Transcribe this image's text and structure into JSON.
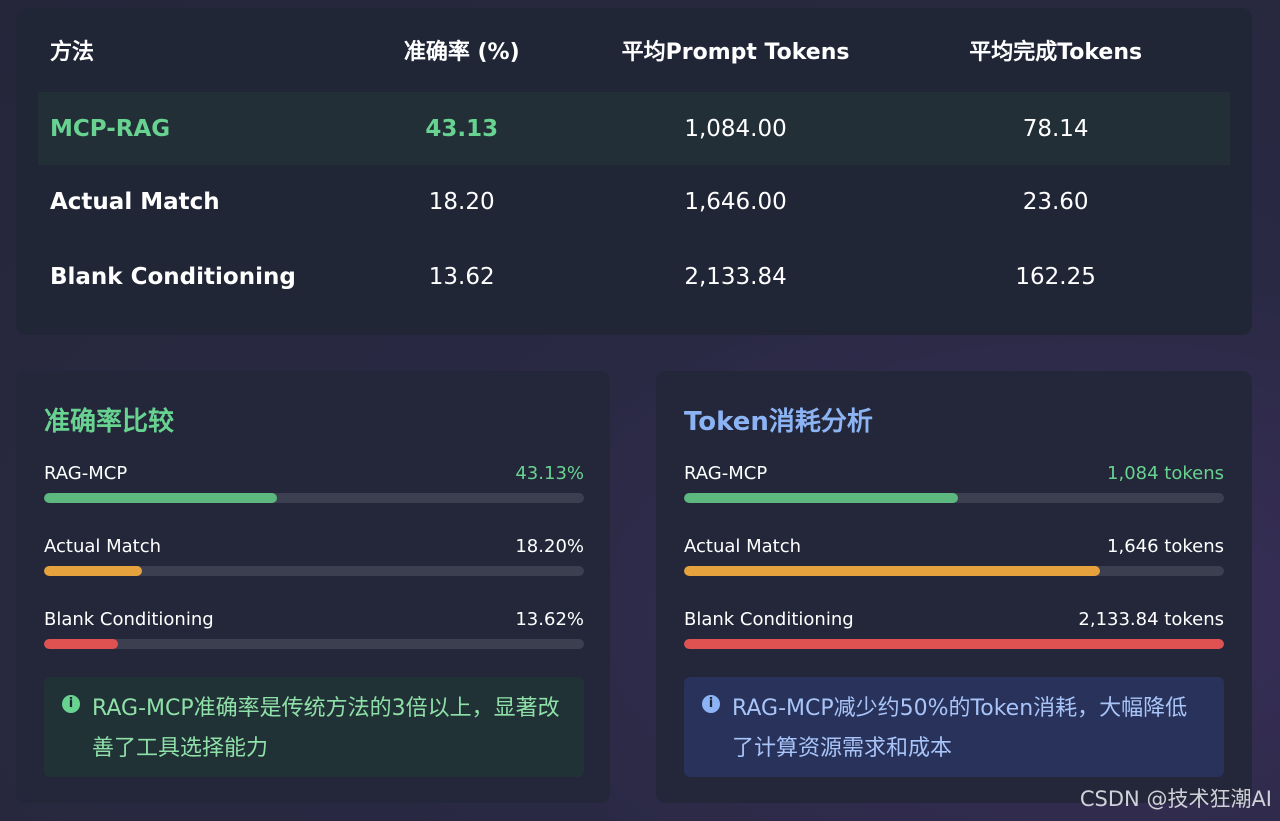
{
  "table": {
    "headers": [
      "方法",
      "准确率 (%)",
      "平均Prompt Tokens",
      "平均完成Tokens"
    ],
    "rows": [
      {
        "method": "MCP-RAG",
        "accuracy": "43.13",
        "prompt_tokens": "1,084.00",
        "completion_tokens": "78.14"
      },
      {
        "method": "Actual Match",
        "accuracy": "18.20",
        "prompt_tokens": "1,646.00",
        "completion_tokens": "23.60"
      },
      {
        "method": "Blank Conditioning",
        "accuracy": "13.62",
        "prompt_tokens": "2,133.84",
        "completion_tokens": "162.25"
      }
    ]
  },
  "accuracy_panel": {
    "title": "准确率比较",
    "bars": [
      {
        "label": "RAG-MCP",
        "value_text": "43.13%",
        "fraction": 0.4313,
        "color": "#5cb87f"
      },
      {
        "label": "Actual Match",
        "value_text": "18.20%",
        "fraction": 0.182,
        "color": "#e6a23c"
      },
      {
        "label": "Blank Conditioning",
        "value_text": "13.62%",
        "fraction": 0.1362,
        "color": "#e05252"
      }
    ],
    "info_icon": "info-circle-icon",
    "info_text": "RAG-MCP准确率是传统方法的3倍以上，显著改善了工具选择能力"
  },
  "token_panel": {
    "title": "Token消耗分析",
    "bars": [
      {
        "label": "RAG-MCP",
        "value_text": "1,084 tokens",
        "fraction": 0.508,
        "color": "#5cb87f"
      },
      {
        "label": "Actual Match",
        "value_text": "1,646 tokens",
        "fraction": 0.771,
        "color": "#e6a23c"
      },
      {
        "label": "Blank Conditioning",
        "value_text": "2,133.84 tokens",
        "fraction": 1.0,
        "color": "#e05252"
      }
    ],
    "info_icon": "info-circle-icon",
    "info_text": "RAG-MCP减少约50%的Token消耗，大幅降低了计算资源需求和成本"
  },
  "watermark": "CSDN @技术狂潮AI",
  "colors": {
    "green_accent": "#68d391",
    "blue_accent": "#8cb4f4"
  }
}
